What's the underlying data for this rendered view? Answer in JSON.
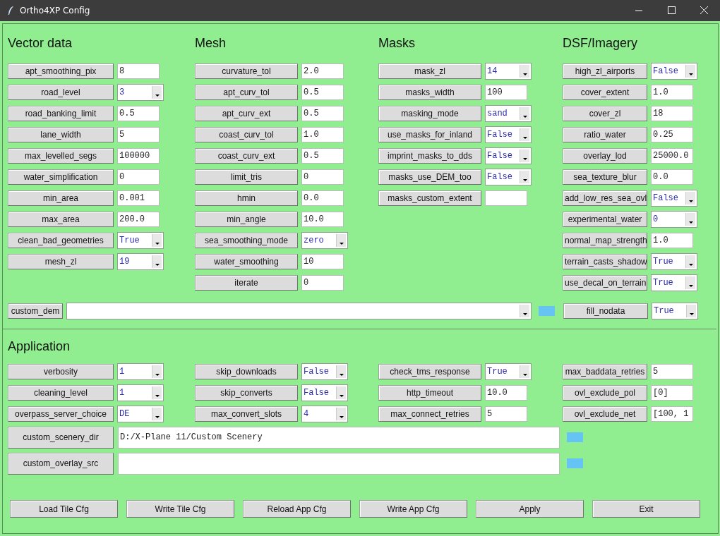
{
  "window": {
    "title": "Ortho4XP Config"
  },
  "sections": [
    {
      "title": "Vector data",
      "fields": [
        {
          "label": "apt_smoothing_pix",
          "value": "8",
          "kind": "entry"
        },
        {
          "label": "road_level",
          "value": "3",
          "kind": "combo"
        },
        {
          "label": "road_banking_limit",
          "value": "0.5",
          "kind": "entry"
        },
        {
          "label": "lane_width",
          "value": "5",
          "kind": "entry"
        },
        {
          "label": "max_levelled_segs",
          "value": "100000",
          "kind": "entry"
        },
        {
          "label": "water_simplification",
          "value": "0",
          "kind": "entry"
        },
        {
          "label": "min_area",
          "value": "0.001",
          "kind": "entry"
        },
        {
          "label": "max_area",
          "value": "200.0",
          "kind": "entry"
        },
        {
          "label": "clean_bad_geometries",
          "value": "True",
          "kind": "combo"
        },
        {
          "label": "mesh_zl",
          "value": "19",
          "kind": "combo"
        }
      ]
    },
    {
      "title": "Mesh",
      "fields": [
        {
          "label": "curvature_tol",
          "value": "2.0",
          "kind": "entry"
        },
        {
          "label": "apt_curv_tol",
          "value": "0.5",
          "kind": "entry"
        },
        {
          "label": "apt_curv_ext",
          "value": "0.5",
          "kind": "entry"
        },
        {
          "label": "coast_curv_tol",
          "value": "1.0",
          "kind": "entry"
        },
        {
          "label": "coast_curv_ext",
          "value": "0.5",
          "kind": "entry"
        },
        {
          "label": "limit_tris",
          "value": "0",
          "kind": "entry"
        },
        {
          "label": "hmin",
          "value": "0.0",
          "kind": "entry"
        },
        {
          "label": "min_angle",
          "value": "10.0",
          "kind": "entry"
        },
        {
          "label": "sea_smoothing_mode",
          "value": "zero",
          "kind": "combo"
        },
        {
          "label": "water_smoothing",
          "value": "10",
          "kind": "entry"
        },
        {
          "label": "iterate",
          "value": "0",
          "kind": "entry"
        }
      ]
    },
    {
      "title": "Masks",
      "fields": [
        {
          "label": "mask_zl",
          "value": "14",
          "kind": "combo"
        },
        {
          "label": "masks_width",
          "value": "100",
          "kind": "entry"
        },
        {
          "label": "masking_mode",
          "value": "sand",
          "kind": "combo"
        },
        {
          "label": "use_masks_for_inland",
          "value": "False",
          "kind": "combo"
        },
        {
          "label": "imprint_masks_to_dds",
          "value": "False",
          "kind": "combo"
        },
        {
          "label": "masks_use_DEM_too",
          "value": "False",
          "kind": "combo"
        },
        {
          "label": "masks_custom_extent",
          "kind": "entry"
        }
      ]
    },
    {
      "title": "DSF/Imagery",
      "fields": [
        {
          "label": "high_zl_airports",
          "value": "False",
          "kind": "combo"
        },
        {
          "label": "cover_extent",
          "value": "1.0",
          "kind": "entry"
        },
        {
          "label": "cover_zl",
          "value": "18",
          "kind": "entry"
        },
        {
          "label": "ratio_water",
          "value": "0.25",
          "kind": "entry"
        },
        {
          "label": "overlay_lod",
          "value": "25000.0",
          "kind": "entry"
        },
        {
          "label": "sea_texture_blur",
          "value": "0.0",
          "kind": "entry"
        },
        {
          "label": "add_low_res_sea_ovl",
          "value": "False",
          "kind": "combo"
        },
        {
          "label": "experimental_water",
          "value": "0",
          "kind": "combo"
        },
        {
          "label": "normal_map_strength",
          "value": "1.0",
          "kind": "entry"
        },
        {
          "label": "terrain_casts_shadow",
          "value": "True",
          "kind": "combo"
        },
        {
          "label": "use_decal_on_terrain",
          "value": "True",
          "kind": "combo"
        }
      ]
    }
  ],
  "custom_dem": {
    "label": "custom_dem",
    "kind": "combo"
  },
  "fill_nodata": {
    "label": "fill_nodata",
    "value": "True",
    "kind": "combo"
  },
  "application": {
    "title": "Application",
    "columns": [
      [
        {
          "label": "verbosity",
          "value": "1",
          "kind": "combo"
        },
        {
          "label": "cleaning_level",
          "value": "1",
          "kind": "combo"
        },
        {
          "label": "overpass_server_choice",
          "value": "DE",
          "kind": "combo"
        }
      ],
      [
        {
          "label": "skip_downloads",
          "value": "False",
          "kind": "combo"
        },
        {
          "label": "skip_converts",
          "value": "False",
          "kind": "combo"
        },
        {
          "label": "max_convert_slots",
          "value": "4",
          "kind": "combo"
        }
      ],
      [
        {
          "label": "check_tms_response",
          "value": "True",
          "kind": "combo"
        },
        {
          "label": "http_timeout",
          "value": "10.0",
          "kind": "entry"
        },
        {
          "label": "max_connect_retries",
          "value": "5",
          "kind": "entry"
        }
      ],
      [
        {
          "label": "max_baddata_retries",
          "value": "5",
          "kind": "entry"
        },
        {
          "label": "ovl_exclude_pol",
          "value": "[0]",
          "kind": "entry"
        },
        {
          "label": "ovl_exclude_net",
          "value": "[100, 1",
          "kind": "entry"
        }
      ]
    ],
    "paths": [
      {
        "label": "custom_scenery_dir",
        "value": "D:/X-Plane 11/Custom Scenery"
      },
      {
        "label": "custom_overlay_src"
      }
    ]
  },
  "buttons": [
    "Load Tile Cfg",
    "Write Tile Cfg",
    "Reload App Cfg",
    "Write App Cfg",
    "Apply",
    "Exit"
  ]
}
